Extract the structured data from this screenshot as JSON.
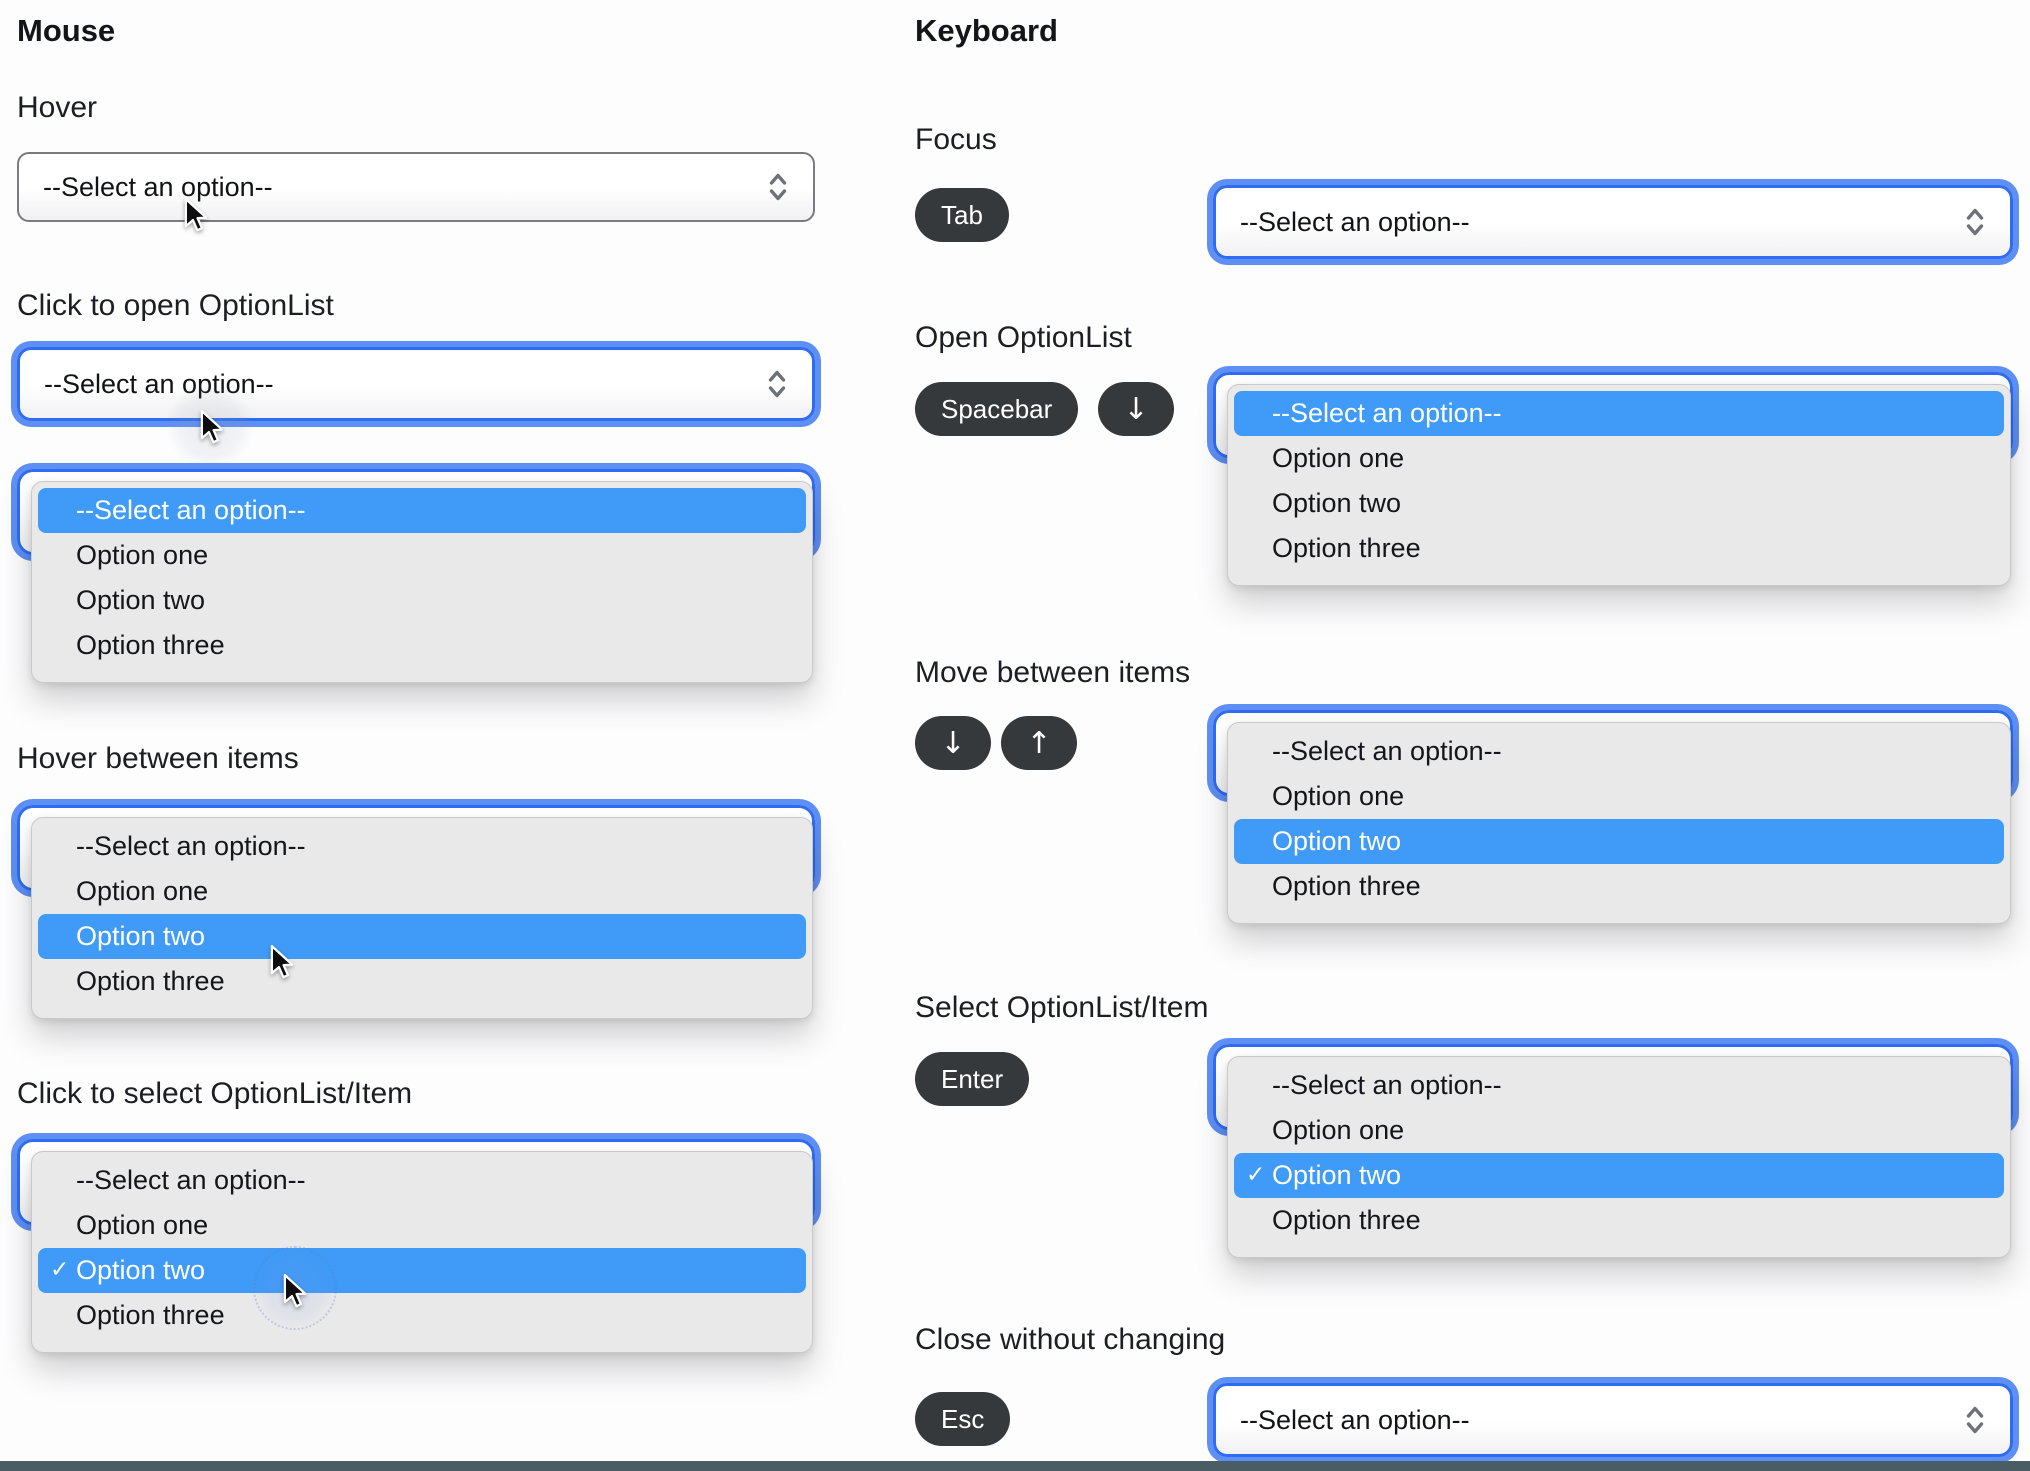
{
  "placeholder": "--Select an option--",
  "options": [
    "--Select an option--",
    "Option one",
    "Option two",
    "Option three"
  ],
  "icons": {
    "check": "✓",
    "arrow_down": "↓",
    "arrow_up": "↑"
  },
  "colors": {
    "highlight": "#3f9bf7",
    "focus_ring_outer": "#5d8ff5",
    "focus_ring_inner": "#2f6cf1",
    "panel_bg": "#e9e9ea",
    "key_bg": "#36393c",
    "bottom_bar": "#4a5c64"
  },
  "mouse": {
    "title": "Mouse",
    "hover": {
      "title": "Hover"
    },
    "open": {
      "title": "Click to open OptionList"
    },
    "hover_items": {
      "title": "Hover between items"
    },
    "select_item": {
      "title": "Click to select OptionList/Item"
    }
  },
  "keyboard": {
    "title": "Keyboard",
    "focus": {
      "title": "Focus",
      "key": "Tab"
    },
    "open": {
      "title": "Open OptionList",
      "key": "Spacebar"
    },
    "move": {
      "title": "Move between items"
    },
    "select_item": {
      "title": "Select OptionList/Item",
      "key": "Enter"
    },
    "close": {
      "title": "Close without changing",
      "key": "Esc"
    }
  }
}
